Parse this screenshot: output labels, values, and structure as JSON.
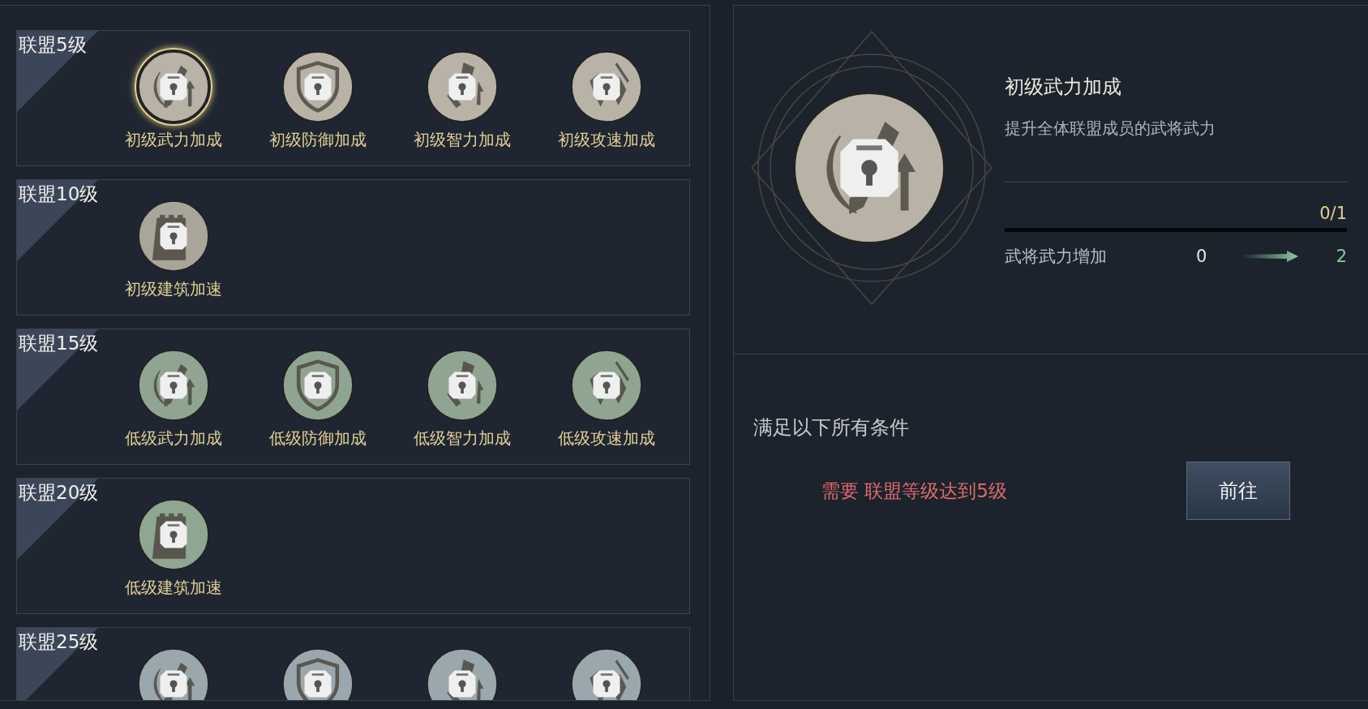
{
  "tech_groups": [
    {
      "title": "联盟5级",
      "color": "#b8b3a6",
      "skills": [
        {
          "kind": "sword",
          "label": "初级武力加成",
          "selected": true
        },
        {
          "kind": "shield",
          "label": "初级防御加成",
          "selected": false
        },
        {
          "kind": "scroll",
          "label": "初级智力加成",
          "selected": false
        },
        {
          "kind": "horse",
          "label": "初级攻速加成",
          "selected": false
        }
      ]
    },
    {
      "title": "联盟10级",
      "color": "#a9a59a",
      "skills": [
        {
          "kind": "tower",
          "label": "初级建筑加速",
          "selected": false
        }
      ]
    },
    {
      "title": "联盟15级",
      "color": "#8fa592",
      "skills": [
        {
          "kind": "sword",
          "label": "低级武力加成",
          "selected": false
        },
        {
          "kind": "shield",
          "label": "低级防御加成",
          "selected": false
        },
        {
          "kind": "scroll",
          "label": "低级智力加成",
          "selected": false
        },
        {
          "kind": "horse",
          "label": "低级攻速加成",
          "selected": false
        }
      ]
    },
    {
      "title": "联盟20级",
      "color": "#8ea692",
      "skills": [
        {
          "kind": "tower",
          "label": "低级建筑加速",
          "selected": false
        }
      ]
    },
    {
      "title": "联盟25级",
      "color": "#9aa7ad",
      "skills": [
        {
          "kind": "sword",
          "selected": false
        },
        {
          "kind": "shield",
          "selected": false
        },
        {
          "kind": "scroll",
          "selected": false
        },
        {
          "kind": "horse",
          "selected": false
        }
      ]
    }
  ],
  "detail": {
    "kind": "sword",
    "title": "初级武力加成",
    "description": "提升全体联盟成员的武将武力",
    "progress": "0/1",
    "level": 0,
    "stat": {
      "label": "武将武力增加",
      "from": "0",
      "to": "2"
    }
  },
  "conditions": {
    "heading": "满足以下所有条件",
    "requirement": "需要 联盟等级达到5级",
    "button": "前往"
  }
}
